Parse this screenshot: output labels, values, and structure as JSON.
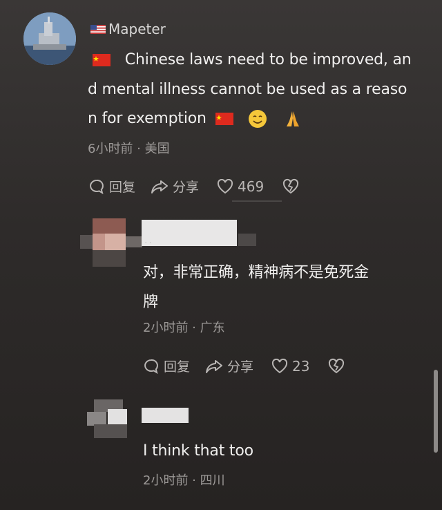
{
  "comment1": {
    "username": "Mapeter",
    "text_lines": [
      "Chinese laws need to be improved, an",
      "d mental illness cannot be used as a reaso",
      "n for exemption"
    ],
    "meta": "6小时前 · 美国",
    "reply_label": "回复",
    "share_label": "分享",
    "likes": "469"
  },
  "reply1": {
    "username": "..",
    "text_lines": [
      "对，非常正确，精神病不是免死金",
      "牌"
    ],
    "meta": "2小时前 · 广东",
    "reply_label": "回复",
    "share_label": "分享",
    "likes": "23"
  },
  "reply2": {
    "text_lines": [
      "I think that too"
    ],
    "meta": "2小时前 · 四川"
  },
  "colors": {
    "background": "#2e2b2a",
    "text": "#f0efee",
    "meta": "#9d9a98",
    "action": "#b9b6b4"
  },
  "icons": [
    "comment-icon",
    "share-icon",
    "heart-icon",
    "broken-heart-icon",
    "china-flag-icon",
    "us-flag-icon",
    "smile-emoji-icon",
    "pray-emoji-icon"
  ]
}
